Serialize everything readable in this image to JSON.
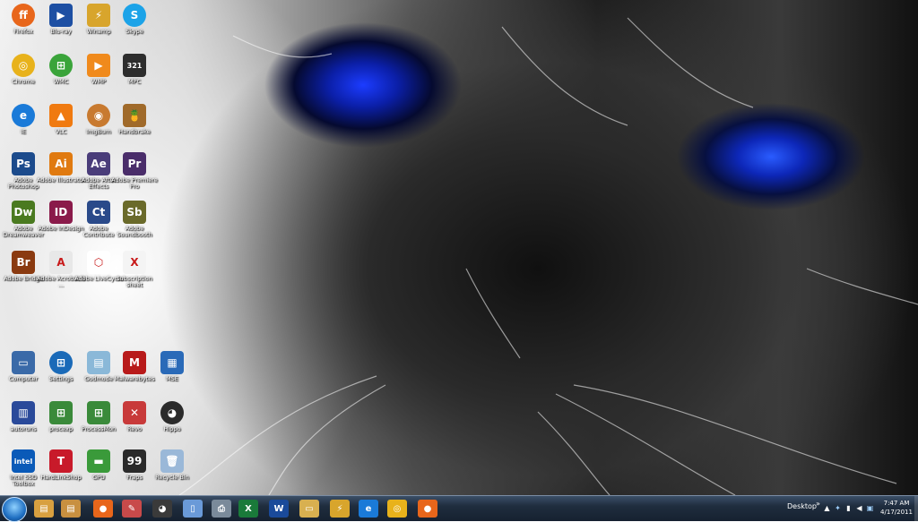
{
  "desktop": {
    "icons": [
      {
        "label": "Firefox",
        "icon": "firefox-icon",
        "color": "#e8661b",
        "glyph": "ff",
        "round": true
      },
      {
        "label": "Blu-ray",
        "icon": "bluray-icon",
        "color": "#1d4fa3",
        "glyph": "▶",
        "round": false
      },
      {
        "label": "Winamp",
        "icon": "winamp-icon",
        "color": "#d8a52c",
        "glyph": "⚡",
        "round": false
      },
      {
        "label": "Skype",
        "icon": "skype-icon",
        "color": "#1ca3e8",
        "glyph": "S",
        "round": true
      },
      {
        "label": "Chrome",
        "icon": "chrome-icon",
        "color": "#e8b21b",
        "glyph": "◎",
        "round": true
      },
      {
        "label": "WMC",
        "icon": "wmc-icon",
        "color": "#3aa43a",
        "glyph": "⊞",
        "round": true
      },
      {
        "label": "WMP",
        "icon": "wmp-icon",
        "color": "#f08a1c",
        "glyph": "▶",
        "round": false
      },
      {
        "label": "MPC",
        "icon": "mpc-icon",
        "color": "#2d2d2d",
        "glyph": "321",
        "round": false
      },
      {
        "label": "IE",
        "icon": "ie-icon",
        "color": "#1a7ad8",
        "glyph": "e",
        "round": true
      },
      {
        "label": "VLC",
        "icon": "vlc-icon",
        "color": "#f07a10",
        "glyph": "▲",
        "round": false
      },
      {
        "label": "ImgBurn",
        "icon": "imgburn-icon",
        "color": "#c87a30",
        "glyph": "◉",
        "round": true
      },
      {
        "label": "Handbrake",
        "icon": "handbrake-icon",
        "color": "#a06a2a",
        "glyph": "🍍",
        "round": false
      },
      {
        "label": "Adobe Photoshop",
        "icon": "photoshop-icon",
        "color": "#1c4b8c",
        "glyph": "Ps",
        "round": false
      },
      {
        "label": "Adobe Illustrator",
        "icon": "illustrator-icon",
        "color": "#e07a10",
        "glyph": "Ai",
        "round": false
      },
      {
        "label": "Adobe After Effects",
        "icon": "aftereffects-icon",
        "color": "#4a3d7a",
        "glyph": "Ae",
        "round": false
      },
      {
        "label": "Adobe Premiere Pro",
        "icon": "premiere-icon",
        "color": "#4a2d6a",
        "glyph": "Pr",
        "round": false
      },
      {
        "label": "Adobe Dreamweaver",
        "icon": "dreamweaver-icon",
        "color": "#4a7a20",
        "glyph": "Dw",
        "round": false
      },
      {
        "label": "Adobe InDesign",
        "icon": "indesign-icon",
        "color": "#8a1a4a",
        "glyph": "ID",
        "round": false
      },
      {
        "label": "Adobe Contribute",
        "icon": "contribute-icon",
        "color": "#2a4a8a",
        "glyph": "Ct",
        "round": false
      },
      {
        "label": "Adobe Soundbooth",
        "icon": "soundbooth-icon",
        "color": "#6a6a2a",
        "glyph": "Sb",
        "round": false
      },
      {
        "label": "Adobe Bridge",
        "icon": "bridge-icon",
        "color": "#8a3a10",
        "glyph": "Br",
        "round": false
      },
      {
        "label": "Adobe Acrobat 9 ...",
        "icon": "acrobat-icon",
        "color": "#e8e8e8",
        "glyph": "A",
        "round": false
      },
      {
        "label": "Adobe LiveCycle",
        "icon": "livecycle-icon",
        "color": "#ffffff",
        "glyph": "⬡",
        "round": false
      },
      {
        "label": "subscription sheet",
        "icon": "excel-file-icon",
        "color": "#f4f4f4",
        "glyph": "X",
        "round": false
      },
      {
        "label": "Computer",
        "icon": "computer-icon",
        "color": "#3a6aa8",
        "glyph": "▭",
        "round": false
      },
      {
        "label": "Settings",
        "icon": "settings-icon",
        "color": "#1a6ab8",
        "glyph": "⊞",
        "round": true
      },
      {
        "label": "Godmode",
        "icon": "godmode-icon",
        "color": "#8ab8d8",
        "glyph": "▤",
        "round": false
      },
      {
        "label": "Malwarebytes",
        "icon": "malwarebytes-icon",
        "color": "#b81a1a",
        "glyph": "M",
        "round": false
      },
      {
        "label": "MSE",
        "icon": "mse-icon",
        "color": "#2a6ab8",
        "glyph": "▦",
        "round": false
      },
      {
        "label": "autoruns",
        "icon": "autoruns-icon",
        "color": "#2a4a9a",
        "glyph": "▥",
        "round": false
      },
      {
        "label": "procexp",
        "icon": "procexp-icon",
        "color": "#3a8a3a",
        "glyph": "⊞",
        "round": false
      },
      {
        "label": "ProcessMon",
        "icon": "procmon-icon",
        "color": "#3a8a3a",
        "glyph": "⊞",
        "round": false
      },
      {
        "label": "Revo",
        "icon": "revo-icon",
        "color": "#c83a3a",
        "glyph": "✕",
        "round": false
      },
      {
        "label": "Hippo",
        "icon": "hippo-icon",
        "color": "#2a2a2a",
        "glyph": "◕",
        "round": true
      },
      {
        "label": "Intel SSD Toolbox",
        "icon": "intel-icon",
        "color": "#0a5ab8",
        "glyph": "intel",
        "round": false
      },
      {
        "label": "HardLinkShop",
        "icon": "hardlinkshop-icon",
        "color": "#c81a2a",
        "glyph": "T",
        "round": false
      },
      {
        "label": "GPU",
        "icon": "gpu-icon",
        "color": "#3a9a3a",
        "glyph": "▬",
        "round": false
      },
      {
        "label": "Fraps",
        "icon": "fraps-icon",
        "color": "#2a2a2a",
        "glyph": "99",
        "round": false
      },
      {
        "label": "Recycle Bin",
        "icon": "recycle-bin-icon",
        "color": "#9ab8d8",
        "glyph": "🗑",
        "round": false
      }
    ]
  },
  "taskbar": {
    "pinned": [
      {
        "icon": "explorer-icon",
        "color": "#d8a040",
        "glyph": "▤"
      },
      {
        "icon": "explorer2-icon",
        "color": "#c89040",
        "glyph": "▤"
      },
      {
        "icon": "firefox-icon",
        "color": "#e8661b",
        "glyph": "●"
      },
      {
        "icon": "paint-icon",
        "color": "#c84a4a",
        "glyph": "✎"
      },
      {
        "icon": "hippo-icon",
        "color": "#3a3a3a",
        "glyph": "◕"
      },
      {
        "icon": "notepad-icon",
        "color": "#6a9ad8",
        "glyph": "▯"
      },
      {
        "icon": "printer-icon",
        "color": "#7a8a9a",
        "glyph": "⎙"
      },
      {
        "icon": "excel-icon",
        "color": "#1a7a3a",
        "glyph": "X"
      },
      {
        "icon": "word-icon",
        "color": "#1a4a9a",
        "glyph": "W"
      },
      {
        "icon": "folder-icon",
        "color": "#d8b050",
        "glyph": "▭"
      },
      {
        "icon": "winamp-icon",
        "color": "#d8a52c",
        "glyph": "⚡"
      },
      {
        "icon": "ie-icon",
        "color": "#1a7ad8",
        "glyph": "e"
      },
      {
        "icon": "chrome-icon",
        "color": "#e8b21b",
        "glyph": "◎"
      },
      {
        "icon": "firefox-icon",
        "color": "#e8661b",
        "glyph": "●"
      }
    ],
    "desktop_label": "Desktop",
    "show_more": "»",
    "clock_time": "7:47 AM",
    "clock_date": "4/17/2011"
  }
}
